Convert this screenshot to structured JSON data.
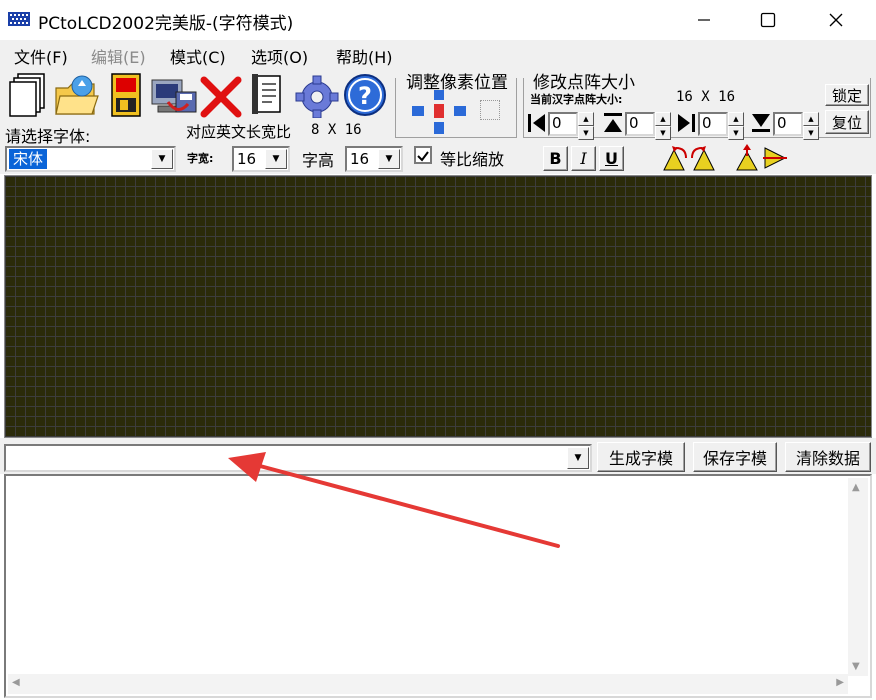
{
  "window": {
    "title": "PCtoLCD2002完美版-(字符模式)"
  },
  "menu": {
    "file": "文件(F)",
    "edit": "编辑(E)",
    "mode": "模式(C)",
    "options": "选项(O)",
    "help": "帮助(H)"
  },
  "adjust_group": {
    "title": "调整像素位置"
  },
  "matrix_group": {
    "title": "修改点阵大小",
    "current_label": "当前汉字点阵大小:",
    "current_value": "16 X 16",
    "lock_button": "锁定",
    "reset_button": "复位",
    "spin_values": [
      "0",
      "0",
      "0",
      "0"
    ]
  },
  "font_row": {
    "select_font_label": "请选择字体:",
    "font_value": "宋体",
    "english_ratio_label": "对应英文长宽比",
    "english_ratio_value": "8 X 16",
    "width_label": "字宽:",
    "width_value": "16",
    "height_label": "字高",
    "height_value": "16",
    "keep_ratio_label": "等比缩放",
    "keep_ratio_checked": true,
    "bold_label": "B",
    "italic_label": "I",
    "underline_label": "U"
  },
  "bottom": {
    "input_value": "",
    "generate_button": "生成字模",
    "save_button": "保存字模",
    "clear_button": "清除数据"
  },
  "colors": {
    "grid_bg": "#2b2b0a",
    "grid_line": "#3d3d3d",
    "annotation_arrow": "#e53935"
  }
}
